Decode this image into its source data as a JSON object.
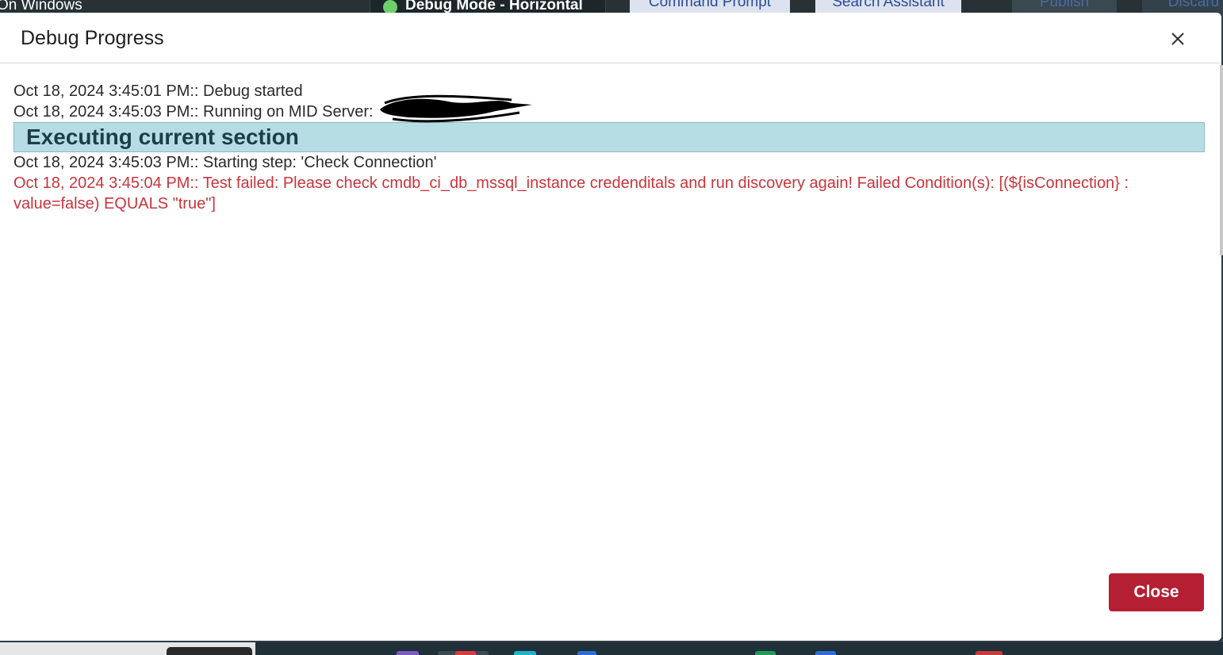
{
  "background": {
    "window_title": "On Windows",
    "debug_mode_label": "Debug Mode - Horizontal",
    "buttons": {
      "command_prompt": "Command Prompt",
      "search_assistant": "Search Assistant",
      "publish": "Publish",
      "discard": "Discard"
    }
  },
  "modal": {
    "title": "Debug Progress",
    "close_button_label": "Close",
    "log": [
      {
        "text": "Oct 18, 2024 3:45:01 PM:: Debug started",
        "type": "info"
      },
      {
        "text": "Oct 18, 2024 3:45:03 PM:: Running on MID Server: ",
        "type": "info"
      },
      {
        "text": "Executing current section",
        "type": "section"
      },
      {
        "text": "Oct 18, 2024 3:45:03 PM:: Starting step: 'Check Connection'",
        "type": "info"
      },
      {
        "text": "Oct 18, 2024 3:45:04 PM:: Test failed: Please check cmdb_ci_db_mssql_instance credenditals and run discovery again! Failed Condition(s): [(${isConnection} : value=false) EQUALS \"true\"]",
        "type": "error"
      }
    ]
  },
  "colors": {
    "section_banner": "#b6dde4",
    "error_text": "#c8353b",
    "close_button": "#b41f33",
    "status_dot": "#6ed06a"
  },
  "icons": {
    "close": "close-icon",
    "status": "status-dot-icon"
  }
}
